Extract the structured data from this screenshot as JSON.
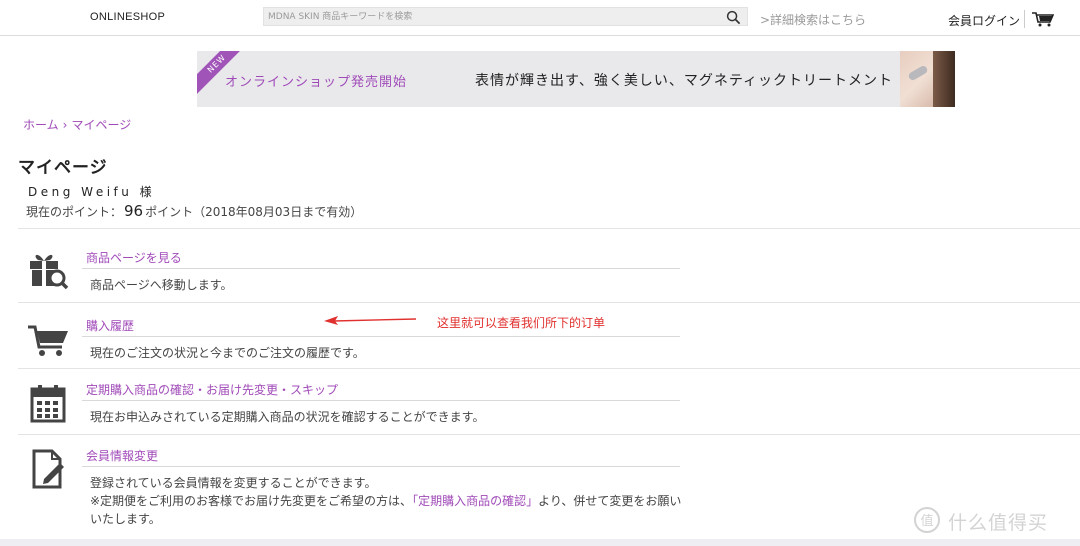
{
  "header": {
    "logo": "ONLINESHOP",
    "search_placeholder": "MDNA SKIN 商品キーワードを検索",
    "advanced_search": ">詳細検索はこちら",
    "login": "会員ログイン",
    "icons": {
      "search": "search-icon",
      "cart": "cart-icon"
    }
  },
  "banner": {
    "badge": "NEW",
    "left_text": "オンラインショップ発売開始",
    "right_text": "表情が輝き出す、強く美しい、マグネティックトリートメント"
  },
  "breadcrumb": {
    "home": "ホーム",
    "separator": "›",
    "current": "マイページ"
  },
  "page": {
    "title": "マイページ",
    "user_name": "Deng Weifu 様",
    "points_label": "現在のポイント：",
    "points_value": "96",
    "points_suffix": "ポイント（2018年08月03日まで有効）"
  },
  "menu": [
    {
      "icon": "gift-search-icon",
      "title": "商品ページを見る",
      "description": "商品ページへ移動します。"
    },
    {
      "icon": "cart-icon",
      "title": "購入履歴",
      "description": "現在のご注文の状況と今までのご注文の履歴です。"
    },
    {
      "icon": "calendar-icon",
      "title": "定期購入商品の確認・お届け先変更・スキップ",
      "description": "現在お申込みされている定期購入商品の状況を確認することができます。"
    },
    {
      "icon": "edit-document-icon",
      "title": "会員情報変更",
      "description": "登録されている会員情報を変更することができます。",
      "note_prefix": "※定期便をご利用のお客様でお届け先変更をご希望の方は、",
      "note_link": "「定期購入商品の確認」",
      "note_suffix": "より、併せて変更をお願いいたします。"
    }
  ],
  "annotation": {
    "text": "这里就可以查看我们所下的订单",
    "color": "#e0312f"
  },
  "watermark": {
    "text": "什么值得买",
    "logo": "值"
  },
  "colors": {
    "accent": "#a04ab8",
    "annotation": "#e0312f"
  }
}
